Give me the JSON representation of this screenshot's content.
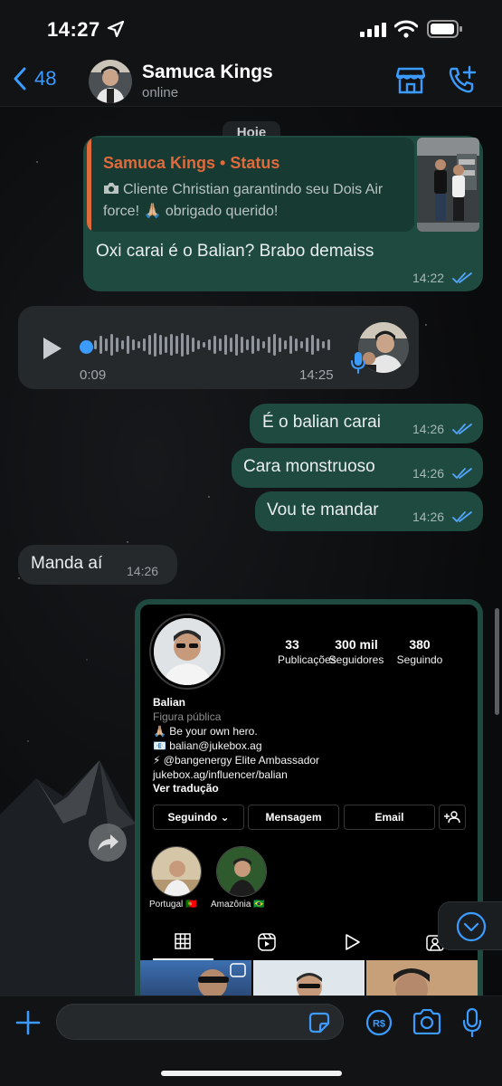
{
  "status_bar": {
    "time": "14:27"
  },
  "header": {
    "back_count": "48",
    "contact_name": "Samuca Kings",
    "contact_status": "online"
  },
  "chat": {
    "date_label": "Hoje",
    "status_reply": {
      "author": "Samuca Kings • Status",
      "quoted_text": "Cliente Christian garantindo seu Dois Air force! 🙏🏼 obrigado querido!",
      "text": "Oxi carai é o Balian? Brabo demaiss",
      "time": "14:22"
    },
    "audio": {
      "duration": "0:09",
      "time": "14:25"
    },
    "messages": [
      {
        "dir": "out",
        "text": "É o balian carai",
        "time": "14:26"
      },
      {
        "dir": "out",
        "text": "Cara monstruoso",
        "time": "14:26"
      },
      {
        "dir": "out",
        "text": "Vou te mandar",
        "time": "14:26"
      },
      {
        "dir": "in",
        "text": "Manda aí",
        "time": "14:26"
      }
    ]
  },
  "instagram": {
    "stats": [
      {
        "num": "33",
        "label": "Publicações"
      },
      {
        "num": "300 mil",
        "label": "Seguidores"
      },
      {
        "num": "380",
        "label": "Seguindo"
      }
    ],
    "name": "Balian",
    "category": "Figura pública",
    "bio_lines": [
      "🙏🏼 Be your own hero.",
      "📧 balian@jukebox.ag",
      "⚡ @bangenergy Elite Ambassador",
      "jukebox.ag/influencer/balian"
    ],
    "translate_label": "Ver tradução",
    "buttons": {
      "following": "Seguindo",
      "message": "Mensagem",
      "email": "Email"
    },
    "highlights": [
      {
        "label": "Portugal 🇵🇹"
      },
      {
        "label": "Amazônia 🇧🇷"
      }
    ]
  },
  "composer": {
    "placeholder": "",
    "value": ""
  },
  "colors": {
    "accent_blue": "#3b9bff",
    "outgoing_bubble": "#1e4a3f",
    "incoming_bubble": "#25292c",
    "status_author": "#e06a3b"
  }
}
